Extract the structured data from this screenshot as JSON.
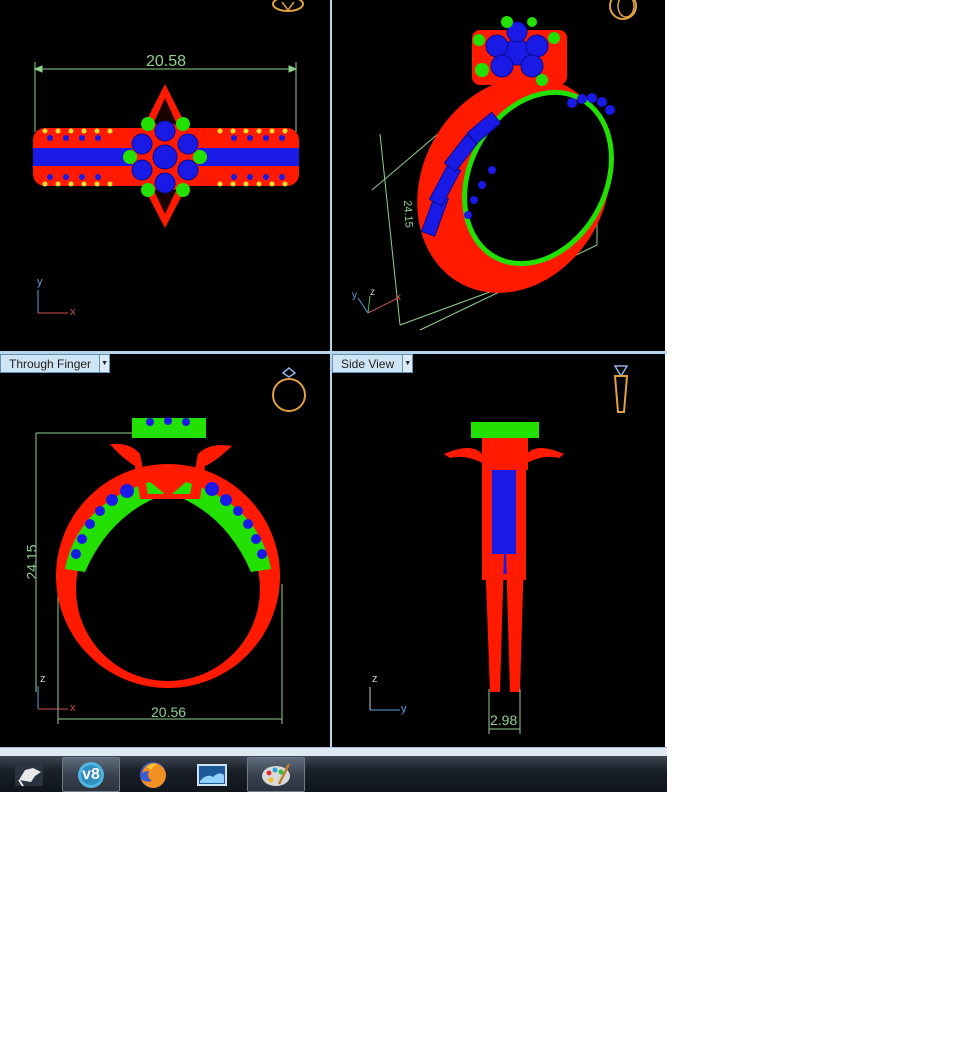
{
  "viewports": {
    "top": {
      "dimension": "20.58",
      "axes": {
        "v": "y",
        "h": "x"
      }
    },
    "perspective": {
      "dimension": "24.15",
      "axes": {
        "y": "y",
        "z": "z",
        "x": "x"
      }
    },
    "front": {
      "title": "Through Finger",
      "height_dim": "24.15",
      "width_dim": "20.56",
      "axes": {
        "v": "z",
        "h": "x"
      }
    },
    "right": {
      "title": "Side View",
      "width_dim": "2.98",
      "axes": {
        "v": "z",
        "h": "y"
      }
    }
  },
  "taskbar": {
    "items": [
      {
        "icon": "rhino-icon"
      },
      {
        "icon": "v8-icon",
        "label": "v8"
      },
      {
        "icon": "firefox-icon"
      },
      {
        "icon": "photo-viewer-icon"
      },
      {
        "icon": "paint-icon"
      }
    ]
  },
  "colors": {
    "viewport_bg": "#000000",
    "metal": "#ff1a00",
    "prongs": "#22e000",
    "stones": "#1a1ae6",
    "dimension": "#8fd18f",
    "accent_frame": "#b7d4ea"
  }
}
